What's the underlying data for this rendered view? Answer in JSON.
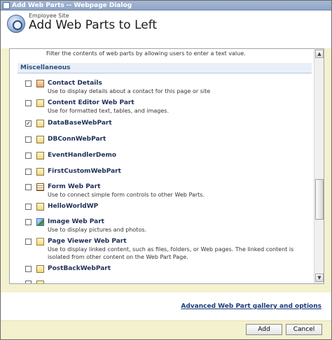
{
  "window": {
    "title": "Add Web Parts -- Webpage Dialog"
  },
  "header": {
    "site_name": "Employee Site",
    "page_title": "Add Web Parts to Left"
  },
  "gallery": {
    "filter_description": "Filter the contents of web parts by allowing users to enter a text value.",
    "category": "Miscellaneous",
    "items": [
      {
        "title": "Contact Details",
        "description": "Use to display details about a contact for this page or site",
        "checked": false,
        "icon": "contact-details-icon"
      },
      {
        "title": "Content Editor Web Part",
        "description": "Use for formatted text, tables, and images.",
        "checked": false,
        "icon": "content-editor-icon"
      },
      {
        "title": "DataBaseWebPart",
        "description": "",
        "checked": true,
        "icon": "webpart-icon"
      },
      {
        "title": "DBConnWebPart",
        "description": "",
        "checked": false,
        "icon": "webpart-icon"
      },
      {
        "title": "EventHandlerDemo",
        "description": "",
        "checked": false,
        "icon": "webpart-icon"
      },
      {
        "title": "FirstCustomWebPart",
        "description": "",
        "checked": false,
        "icon": "webpart-icon"
      },
      {
        "title": "Form Web Part",
        "description": "Use to connect simple form controls to other Web Parts.",
        "checked": false,
        "icon": "form-icon"
      },
      {
        "title": "HelloWorldWP",
        "description": "",
        "checked": false,
        "icon": "webpart-icon"
      },
      {
        "title": "Image Web Part",
        "description": "Use to display pictures and photos.",
        "checked": false,
        "icon": "image-icon"
      },
      {
        "title": "Page Viewer Web Part",
        "description": "Use to display linked content, such as files, folders, or Web pages. The linked content is isolated from other content on the Web Part Page.",
        "checked": false,
        "icon": "page-viewer-icon"
      },
      {
        "title": "PostBackWebPart",
        "description": "",
        "checked": false,
        "icon": "webpart-icon"
      }
    ]
  },
  "links": {
    "advanced": "Advanced Web Part gallery and options"
  },
  "buttons": {
    "add": "Add",
    "cancel": "Cancel"
  },
  "colors": {
    "title_bar": "#8fa6c8",
    "body_background": "#f4f1cf",
    "category_background": "#e9eff8",
    "link": "#1a3b7a"
  }
}
